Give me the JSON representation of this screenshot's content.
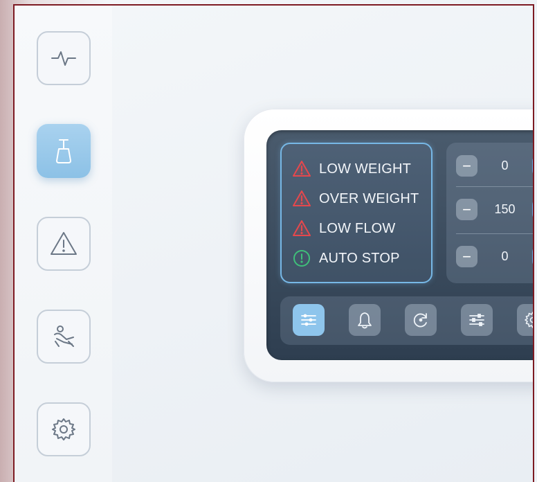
{
  "sidebar": {
    "items": [
      {
        "name": "vital-signs",
        "icon": "pulse-icon",
        "active": false
      },
      {
        "name": "feeding-bag",
        "icon": "feeding-bag-icon",
        "active": true
      },
      {
        "name": "warnings",
        "icon": "warning-icon",
        "active": false
      },
      {
        "name": "patient",
        "icon": "patient-recline-icon",
        "active": false
      },
      {
        "name": "settings",
        "icon": "gear-icon",
        "active": false
      }
    ]
  },
  "alarms": [
    {
      "label": "LOW WEIGHT",
      "status": "warning",
      "icon": "warning-triangle-icon",
      "color": "#e5484d"
    },
    {
      "label": "OVER WEIGHT",
      "status": "warning",
      "icon": "warning-triangle-icon",
      "color": "#e5484d"
    },
    {
      "label": "LOW FLOW",
      "status": "warning",
      "icon": "warning-triangle-icon",
      "color": "#e5484d"
    },
    {
      "label": "AUTO STOP",
      "status": "ok",
      "icon": "info-circle-icon",
      "color": "#3fc07a"
    }
  ],
  "steppers": [
    {
      "value": "0",
      "minus": "−",
      "plus": "+"
    },
    {
      "value": "150",
      "minus": "−",
      "plus": "+"
    },
    {
      "value": "0",
      "minus": "−",
      "plus": "+"
    }
  ],
  "bottom_nav": [
    {
      "icon": "sliders-list-icon",
      "active": true
    },
    {
      "icon": "bell-icon",
      "active": false
    },
    {
      "icon": "refresh-cycle-icon",
      "active": false
    },
    {
      "icon": "sliders-icon",
      "active": false
    },
    {
      "icon": "gear-icon",
      "active": false
    }
  ],
  "colors": {
    "accent": "#62a7df",
    "active_tile": "#8cc1e6",
    "frame_border": "#7d1a22",
    "screen_bg": "#3a4a5c"
  }
}
